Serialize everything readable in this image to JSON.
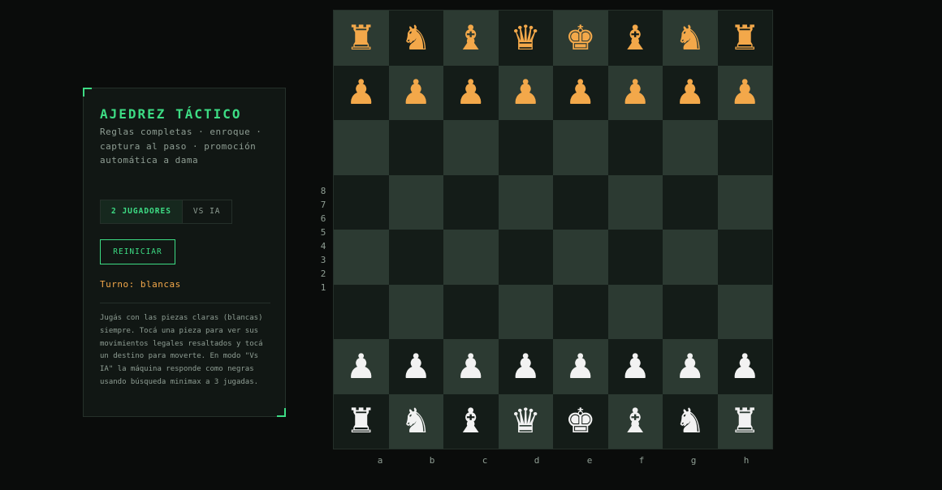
{
  "panel": {
    "title": "AJEDREZ TÁCTICO",
    "subtitle": "Reglas completas · enroque · captura al paso · promoción automática a dama",
    "modes": [
      {
        "label": "2 JUGADORES",
        "active": true
      },
      {
        "label": "VS IA",
        "active": false
      }
    ],
    "reset_label": "REINICIAR",
    "turn": "Turno: blancas",
    "help": "Jugás con las piezas claras (blancas) siempre. Tocá una pieza para ver sus movimientos legales resaltados y tocá un destino para moverte. En modo \"Vs IA\" la máquina responde como negras usando búsqueda minimax a 3 jugadas."
  },
  "board": {
    "rows": [
      [
        "r",
        "n",
        "b",
        "q",
        "k",
        "b",
        "n",
        "r"
      ],
      [
        "p",
        "p",
        "p",
        "p",
        "p",
        "p",
        "p",
        "p"
      ],
      [
        "",
        "",
        "",
        "",
        "",
        "",
        "",
        ""
      ],
      [
        "",
        "",
        "",
        "",
        "",
        "",
        "",
        ""
      ],
      [
        "",
        "",
        "",
        "",
        "",
        "",
        "",
        ""
      ],
      [
        "",
        "",
        "",
        "",
        "",
        "",
        "",
        ""
      ],
      [
        "P",
        "P",
        "P",
        "P",
        "P",
        "P",
        "P",
        "P"
      ],
      [
        "R",
        "N",
        "B",
        "Q",
        "K",
        "B",
        "N",
        "R"
      ]
    ],
    "rank_labels": [
      "8",
      "7",
      "6",
      "5",
      "4",
      "3",
      "2",
      "1"
    ],
    "file_labels": [
      "a",
      "b",
      "c",
      "d",
      "e",
      "f",
      "g",
      "h"
    ],
    "colors": {
      "light_square": "#2c3a32",
      "dark_square": "#141c18",
      "black_piece": "#f3a84a",
      "white_piece": "#f2f2f2",
      "accent": "#3ddc84"
    }
  }
}
